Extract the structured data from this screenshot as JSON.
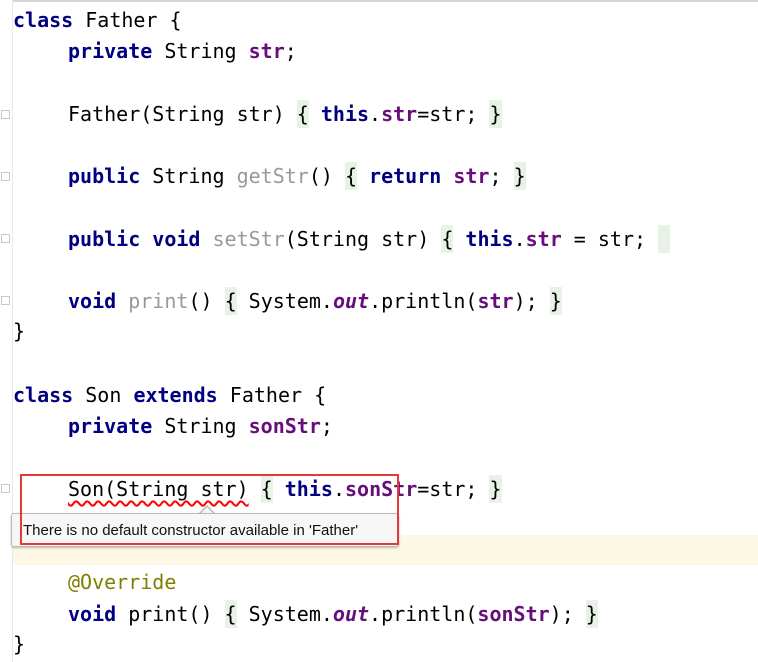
{
  "father_class": {
    "kw_class": "class",
    "name_header": " Father {",
    "decl_kw": "private",
    "decl_type": " String ",
    "decl_field": "str",
    "decl_end": ";",
    "ctor_sig": "Father(String str) ",
    "ctor_open": "{",
    "ctor_this": "this",
    "ctor_dot": ".",
    "ctor_field": "str",
    "ctor_assign": "=str; ",
    "ctor_close": "}",
    "getter_kw": "public",
    "getter_type": " String ",
    "getter_name": "getStr",
    "getter_parens": "() ",
    "getter_open": "{",
    "getter_ret": "return",
    "getter_field": "str",
    "getter_semi": "; ",
    "getter_close": "}",
    "setter_kw1": "public",
    "setter_kw2": "void",
    "setter_name": "setStr",
    "setter_params": "(String str) ",
    "setter_open": "{",
    "setter_this": "this",
    "setter_dot": ".",
    "setter_field": "str",
    "setter_assign": " = str; ",
    "print_kw": "void",
    "print_name": "print",
    "print_parens": "() ",
    "print_open": "{",
    "print_sys": " System.",
    "print_out": "out",
    "print_call": ".println(",
    "print_field": "str",
    "print_end": "); ",
    "print_close": "}",
    "class_close": "}"
  },
  "son_class": {
    "kw_class": "class",
    "name": " Son ",
    "kw_extends": "extends",
    "parent": " Father {",
    "decl_kw": "private",
    "decl_type": " String ",
    "decl_field": "sonStr",
    "decl_end": ";",
    "ctor_sig": "Son(String str)",
    "ctor_space": " ",
    "ctor_open": "{",
    "ctor_this": "this",
    "ctor_dot": ".",
    "ctor_field": "sonStr",
    "ctor_assign": "=str; ",
    "ctor_close": "}",
    "annotation": "@Override",
    "print_kw": "void",
    "print_name": " print() ",
    "print_open": "{",
    "print_sys": " System.",
    "print_out": "out",
    "print_call": ".println(",
    "print_field": "sonStr",
    "print_end": "); ",
    "print_close": "}",
    "class_close": "}"
  },
  "error_tooltip": {
    "message": "There is no default constructor available in 'Father'"
  },
  "colors": {
    "keyword": "#000080",
    "field": "#660e7a",
    "annotation": "#808000",
    "unused_method": "#999999",
    "fold_bg": "#e8f2e6",
    "current_line": "#fdf8e4",
    "error_underline": "#ff0000",
    "callout_border": "#e53935"
  }
}
